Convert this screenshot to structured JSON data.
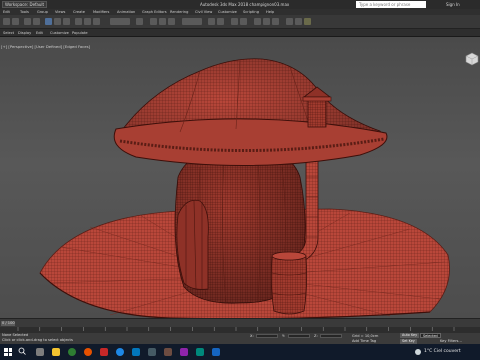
{
  "window": {
    "workspace_label": "Workspace: Default",
    "app_title": "Autodesk 3ds Max 2018   champignon03.max",
    "search_placeholder": "Type a keyword or phrase",
    "sign_in": "Sign In"
  },
  "menubar": {
    "items": [
      "Edit",
      "Tools",
      "Group",
      "Views",
      "Create",
      "Modifiers",
      "Animation",
      "Graph Editors",
      "Rendering",
      "Civil View",
      "Customize",
      "Scripting",
      "Help"
    ]
  },
  "ribbon": {
    "tabs": [
      "Select",
      "Display",
      "Edit",
      "Customize",
      "Populate"
    ]
  },
  "viewport": {
    "label": "[+] [Perspective] [User Defined] [Edged Faces]",
    "model": "mushroom-house"
  },
  "timeline": {
    "frame_counter": "0 / 100",
    "ticks": [
      "0",
      "5",
      "10",
      "15",
      "20",
      "25",
      "30",
      "35",
      "40",
      "45",
      "50",
      "55",
      "60",
      "65",
      "70",
      "75",
      "80",
      "85",
      "90",
      "95",
      "100"
    ]
  },
  "statusbar": {
    "selection_info": "None Selected",
    "prompt": "Click or click-and-drag to select objects",
    "x_label": "X:",
    "y_label": "Y:",
    "z_label": "Z:",
    "grid_label": "Grid = 10,0cm",
    "auto_key": "Auto Key",
    "set_key": "Set Key",
    "selected_value": "Selected",
    "key_filters": "Key Filters...",
    "add_time_tag": "Add Time Tag"
  },
  "taskbar": {
    "weather": "1°C  Ciel couvert"
  },
  "colors": {
    "model_red": "#b9473a",
    "model_wire": "#5a1d15",
    "viewport_bg": "#555555",
    "taskbar_bg": "#101a2a"
  }
}
